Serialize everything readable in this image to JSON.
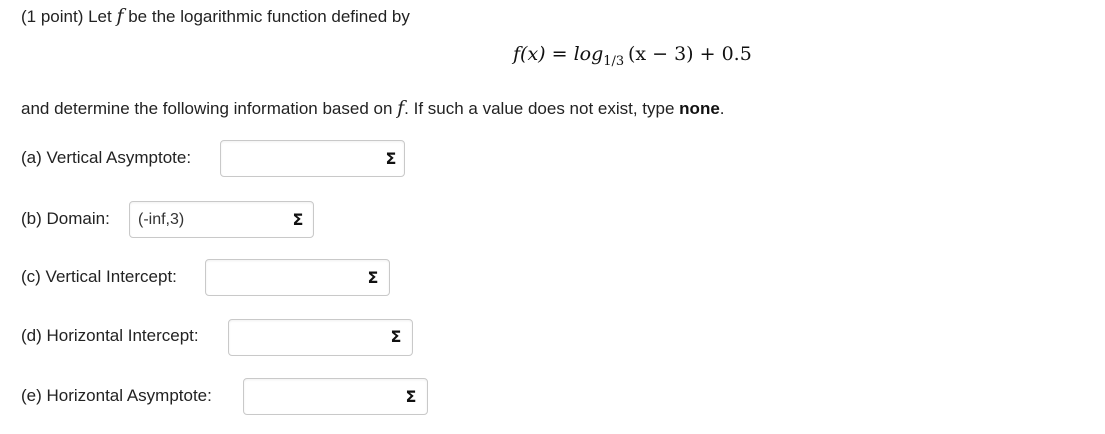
{
  "problem": {
    "intro_prefix": "(1 point) Let ",
    "fname": "f",
    "intro_suffix": " be the logarithmic function defined by",
    "formula": {
      "lhs": "f(x) = log",
      "base": "1/3",
      "rhs": "(x − 3) + 0.5"
    },
    "instruction_prefix": "and determine the following information based on ",
    "instruction_mid": ". If such a value does not exist, type ",
    "instruction_keyword": "none",
    "instruction_end": "."
  },
  "questions": [
    {
      "label": "(a) Vertical Asymptote:",
      "value": "",
      "icon": "sigma-icon"
    },
    {
      "label": "(b) Domain:",
      "value": "(-inf,3)",
      "icon": "sigma-icon"
    },
    {
      "label": "(c) Vertical Intercept:",
      "value": "",
      "icon": "sigma-icon"
    },
    {
      "label": "(d) Horizontal Intercept:",
      "value": "",
      "icon": "sigma-icon"
    },
    {
      "label": "(e) Horizontal Asymptote:",
      "value": "",
      "icon": "sigma-icon"
    }
  ],
  "icons": {
    "sigma_glyph": "Σ"
  }
}
